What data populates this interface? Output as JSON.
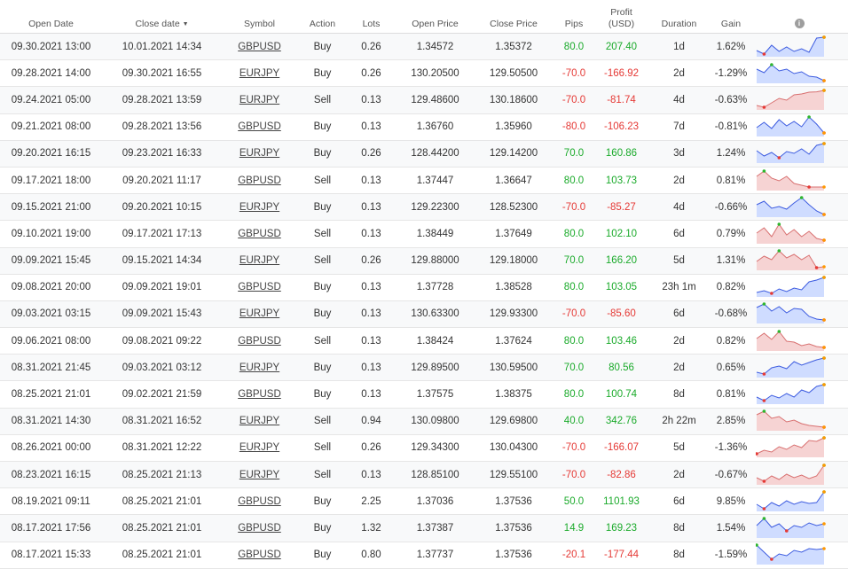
{
  "headers": {
    "open_date": "Open Date",
    "close_date": "Close date",
    "sort_arrow": "▼",
    "symbol": "Symbol",
    "action": "Action",
    "lots": "Lots",
    "open_price": "Open Price",
    "close_price": "Close Price",
    "pips": "Pips",
    "profit_line1": "Profit",
    "profit_line2": "(USD)",
    "duration": "Duration",
    "gain": "Gain",
    "info_icon": "i"
  },
  "colors": {
    "positive": "#1aaa2a",
    "negative": "#e53935",
    "spark_up_fill": "#cfdcff",
    "spark_up_line": "#3d5ce0",
    "spark_down_fill": "#f6d3d3",
    "spark_down_line": "#d87070",
    "spark_start": "#e53935",
    "spark_high": "#2db52d",
    "spark_end": "#ff9800"
  },
  "rows": [
    {
      "open_date": "09.30.2021 13:00",
      "close_date": "10.01.2021 14:34",
      "symbol": "GBPUSD",
      "action": "Buy",
      "lots": "0.26",
      "open_price": "1.34572",
      "close_price": "1.35372",
      "pips": "80.0",
      "profit": "207.40",
      "duration": "1d",
      "gain": "1.62%",
      "trend": "up",
      "spark": [
        0.25,
        0.05,
        0.55,
        0.2,
        0.45,
        0.2,
        0.35,
        0.15,
        0.95,
        1.0
      ]
    },
    {
      "open_date": "09.28.2021 14:00",
      "close_date": "09.30.2021 16:55",
      "symbol": "EURJPY",
      "action": "Buy",
      "lots": "0.26",
      "open_price": "130.20500",
      "close_price": "129.50500",
      "pips": "-70.0",
      "profit": "-166.92",
      "duration": "2d",
      "gain": "-1.29%",
      "trend": "up",
      "spark": [
        0.7,
        0.5,
        0.95,
        0.6,
        0.7,
        0.45,
        0.55,
        0.3,
        0.25,
        0.05
      ]
    },
    {
      "open_date": "09.24.2021 05:00",
      "close_date": "09.28.2021 13:59",
      "symbol": "EURJPY",
      "action": "Sell",
      "lots": "0.13",
      "open_price": "129.48600",
      "close_price": "130.18600",
      "pips": "-70.0",
      "profit": "-81.74",
      "duration": "4d",
      "gain": "-0.63%",
      "trend": "down",
      "spark": [
        0.15,
        0.05,
        0.3,
        0.55,
        0.45,
        0.75,
        0.8,
        0.9,
        0.92,
        1.0
      ]
    },
    {
      "open_date": "09.21.2021 08:00",
      "close_date": "09.28.2021 13:56",
      "symbol": "GBPUSD",
      "action": "Buy",
      "lots": "0.13",
      "open_price": "1.36760",
      "close_price": "1.35960",
      "pips": "-80.0",
      "profit": "-106.23",
      "duration": "7d",
      "gain": "-0.81%",
      "trend": "up",
      "spark": [
        0.4,
        0.7,
        0.35,
        0.85,
        0.5,
        0.75,
        0.45,
        1.0,
        0.6,
        0.1
      ]
    },
    {
      "open_date": "09.20.2021 16:15",
      "close_date": "09.23.2021 16:33",
      "symbol": "EURJPY",
      "action": "Buy",
      "lots": "0.26",
      "open_price": "128.44200",
      "close_price": "129.14200",
      "pips": "70.0",
      "profit": "160.86",
      "duration": "3d",
      "gain": "1.24%",
      "trend": "up",
      "spark": [
        0.6,
        0.3,
        0.5,
        0.2,
        0.55,
        0.45,
        0.7,
        0.4,
        0.9,
        1.0
      ]
    },
    {
      "open_date": "09.17.2021 18:00",
      "close_date": "09.20.2021 11:17",
      "symbol": "GBPUSD",
      "action": "Sell",
      "lots": "0.13",
      "open_price": "1.37447",
      "close_price": "1.36647",
      "pips": "80.0",
      "profit": "103.73",
      "duration": "2d",
      "gain": "0.81%",
      "trend": "down",
      "spark": [
        0.7,
        1.0,
        0.6,
        0.45,
        0.7,
        0.3,
        0.2,
        0.1,
        0.1,
        0.1
      ]
    },
    {
      "open_date": "09.15.2021 21:00",
      "close_date": "09.20.2021 10:15",
      "symbol": "EURJPY",
      "action": "Buy",
      "lots": "0.13",
      "open_price": "129.22300",
      "close_price": "128.52300",
      "pips": "-70.0",
      "profit": "-85.27",
      "duration": "4d",
      "gain": "-0.66%",
      "trend": "up",
      "spark": [
        0.6,
        0.8,
        0.4,
        0.5,
        0.35,
        0.7,
        1.0,
        0.6,
        0.25,
        0.05
      ]
    },
    {
      "open_date": "09.10.2021 19:00",
      "close_date": "09.17.2021 17:13",
      "symbol": "GBPUSD",
      "action": "Sell",
      "lots": "0.13",
      "open_price": "1.38449",
      "close_price": "1.37649",
      "pips": "80.0",
      "profit": "102.10",
      "duration": "6d",
      "gain": "0.79%",
      "trend": "down",
      "spark": [
        0.5,
        0.8,
        0.3,
        1.0,
        0.4,
        0.7,
        0.3,
        0.6,
        0.2,
        0.1
      ]
    },
    {
      "open_date": "09.09.2021 15:45",
      "close_date": "09.15.2021 14:34",
      "symbol": "EURJPY",
      "action": "Sell",
      "lots": "0.26",
      "open_price": "129.88000",
      "close_price": "129.18000",
      "pips": "70.0",
      "profit": "166.20",
      "duration": "5d",
      "gain": "1.31%",
      "trend": "down",
      "spark": [
        0.4,
        0.7,
        0.5,
        1.0,
        0.6,
        0.8,
        0.5,
        0.75,
        0.05,
        0.1
      ]
    },
    {
      "open_date": "09.08.2021 20:00",
      "close_date": "09.09.2021 19:01",
      "symbol": "GBPUSD",
      "action": "Buy",
      "lots": "0.13",
      "open_price": "1.37728",
      "close_price": "1.38528",
      "pips": "80.0",
      "profit": "103.05",
      "duration": "23h 1m",
      "gain": "0.82%",
      "trend": "up",
      "spark": [
        0.15,
        0.25,
        0.1,
        0.35,
        0.2,
        0.4,
        0.3,
        0.75,
        0.85,
        1.0
      ]
    },
    {
      "open_date": "09.03.2021 03:15",
      "close_date": "09.09.2021 15:43",
      "symbol": "EURJPY",
      "action": "Buy",
      "lots": "0.13",
      "open_price": "130.63300",
      "close_price": "129.93300",
      "pips": "-70.0",
      "profit": "-85.60",
      "duration": "6d",
      "gain": "-0.68%",
      "trend": "up",
      "spark": [
        0.8,
        1.0,
        0.6,
        0.85,
        0.5,
        0.75,
        0.7,
        0.3,
        0.15,
        0.1
      ]
    },
    {
      "open_date": "09.06.2021 08:00",
      "close_date": "09.08.2021 09:22",
      "symbol": "GBPUSD",
      "action": "Sell",
      "lots": "0.13",
      "open_price": "1.38424",
      "close_price": "1.37624",
      "pips": "80.0",
      "profit": "103.46",
      "duration": "2d",
      "gain": "0.82%",
      "trend": "down",
      "spark": [
        0.6,
        0.9,
        0.55,
        1.0,
        0.45,
        0.4,
        0.2,
        0.3,
        0.15,
        0.1
      ]
    },
    {
      "open_date": "08.31.2021 21:45",
      "close_date": "09.03.2021 03:12",
      "symbol": "EURJPY",
      "action": "Buy",
      "lots": "0.13",
      "open_price": "129.89500",
      "close_price": "130.59500",
      "pips": "70.0",
      "profit": "80.56",
      "duration": "2d",
      "gain": "0.65%",
      "trend": "up",
      "spark": [
        0.2,
        0.1,
        0.45,
        0.55,
        0.4,
        0.8,
        0.6,
        0.75,
        0.9,
        1.0
      ]
    },
    {
      "open_date": "08.25.2021 21:01",
      "close_date": "09.02.2021 21:59",
      "symbol": "GBPUSD",
      "action": "Buy",
      "lots": "0.13",
      "open_price": "1.37575",
      "close_price": "1.38375",
      "pips": "80.0",
      "profit": "100.74",
      "duration": "8d",
      "gain": "0.81%",
      "trend": "up",
      "spark": [
        0.3,
        0.1,
        0.4,
        0.25,
        0.5,
        0.3,
        0.7,
        0.55,
        0.9,
        1.0
      ]
    },
    {
      "open_date": "08.31.2021 14:30",
      "close_date": "08.31.2021 16:52",
      "symbol": "EURJPY",
      "action": "Sell",
      "lots": "0.94",
      "open_price": "130.09800",
      "close_price": "129.69800",
      "pips": "40.0",
      "profit": "342.76",
      "duration": "2h 22m",
      "gain": "2.85%",
      "trend": "down",
      "spark": [
        0.8,
        1.0,
        0.6,
        0.7,
        0.4,
        0.5,
        0.3,
        0.2,
        0.15,
        0.1
      ]
    },
    {
      "open_date": "08.26.2021 00:00",
      "close_date": "08.31.2021 12:22",
      "symbol": "EURJPY",
      "action": "Sell",
      "lots": "0.26",
      "open_price": "129.34300",
      "close_price": "130.04300",
      "pips": "-70.0",
      "profit": "-166.07",
      "duration": "5d",
      "gain": "-1.36%",
      "trend": "down",
      "spark": [
        0.1,
        0.3,
        0.2,
        0.5,
        0.35,
        0.6,
        0.45,
        0.85,
        0.8,
        1.0
      ]
    },
    {
      "open_date": "08.23.2021 16:15",
      "close_date": "08.25.2021 21:13",
      "symbol": "EURJPY",
      "action": "Sell",
      "lots": "0.13",
      "open_price": "128.85100",
      "close_price": "129.55100",
      "pips": "-70.0",
      "profit": "-82.86",
      "duration": "2d",
      "gain": "-0.67%",
      "trend": "down",
      "spark": [
        0.3,
        0.1,
        0.4,
        0.2,
        0.5,
        0.3,
        0.45,
        0.25,
        0.4,
        1.0
      ]
    },
    {
      "open_date": "08.19.2021 09:11",
      "close_date": "08.25.2021 21:01",
      "symbol": "GBPUSD",
      "action": "Buy",
      "lots": "2.25",
      "open_price": "1.37036",
      "close_price": "1.37536",
      "pips": "50.0",
      "profit": "1101.93",
      "duration": "6d",
      "gain": "9.85%",
      "trend": "up",
      "spark": [
        0.3,
        0.05,
        0.4,
        0.2,
        0.5,
        0.3,
        0.45,
        0.35,
        0.4,
        1.0
      ]
    },
    {
      "open_date": "08.17.2021 17:56",
      "close_date": "08.25.2021 21:01",
      "symbol": "GBPUSD",
      "action": "Buy",
      "lots": "1.32",
      "open_price": "1.37387",
      "close_price": "1.37536",
      "pips": "14.9",
      "profit": "169.23",
      "duration": "8d",
      "gain": "1.54%",
      "trend": "up",
      "spark": [
        0.6,
        1.0,
        0.5,
        0.7,
        0.3,
        0.6,
        0.5,
        0.75,
        0.6,
        0.7
      ]
    },
    {
      "open_date": "08.17.2021 15:33",
      "close_date": "08.25.2021 21:01",
      "symbol": "GBPUSD",
      "action": "Buy",
      "lots": "0.80",
      "open_price": "1.37737",
      "close_price": "1.37536",
      "pips": "-20.1",
      "profit": "-177.44",
      "duration": "8d",
      "gain": "-1.59%",
      "trend": "up",
      "spark": [
        1.0,
        0.6,
        0.2,
        0.5,
        0.4,
        0.7,
        0.6,
        0.8,
        0.75,
        0.8
      ]
    }
  ]
}
